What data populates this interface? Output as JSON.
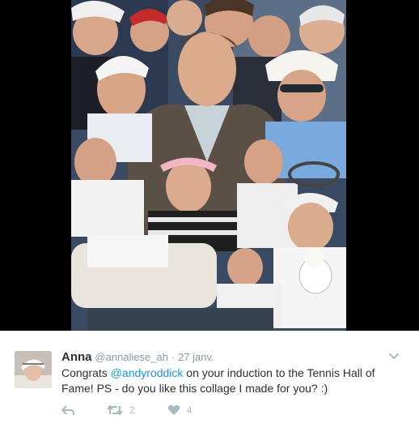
{
  "media": {
    "alt_icon": "tennis-collage-image"
  },
  "tweet": {
    "display_name": "Anna",
    "handle": "@annaliese_ah",
    "separator": "·",
    "date": "27 janv.",
    "text_before": "Congrats ",
    "mention": "@andyroddick",
    "text_after": " on your induction to the Tennis Hall of Fame! PS - do you like this collage I made for you? :)",
    "reply_icon": "reply-icon",
    "retweet_icon": "retweet-icon",
    "retweet_count": "2",
    "like_icon": "heart-icon",
    "like_count": "4",
    "menu_icon": "chevron-down-icon"
  },
  "colors": {
    "mention": "#1b95e0",
    "meta": "#8899a6",
    "action": "#aab8c2",
    "text": "#292f33"
  }
}
